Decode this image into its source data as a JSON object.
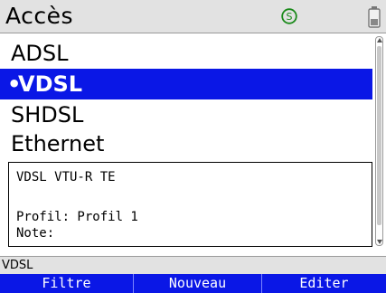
{
  "header": {
    "title": "Accès",
    "sync_icon": "sync-status-icon",
    "sync_symbol": "S",
    "battery_icon": "battery-icon"
  },
  "list": {
    "items": [
      {
        "label": "ADSL",
        "selected": false
      },
      {
        "label": "VDSL",
        "selected": true
      },
      {
        "label": "SHDSL",
        "selected": false
      },
      {
        "label": "Ethernet",
        "selected": false
      }
    ],
    "selected_bullet": "•"
  },
  "details": {
    "line1": "VDSL VTU-R TE",
    "line2": "Profil: Profil 1",
    "line3": "Note:"
  },
  "status": {
    "text": "VDSL"
  },
  "softkeys": [
    {
      "label": "Filtre"
    },
    {
      "label": "Nouveau"
    },
    {
      "label": "Editer"
    }
  ],
  "colors": {
    "accent": "#0a17e6",
    "sync_icon": "#1a8a1a",
    "header_bg": "#e2e2e2"
  }
}
